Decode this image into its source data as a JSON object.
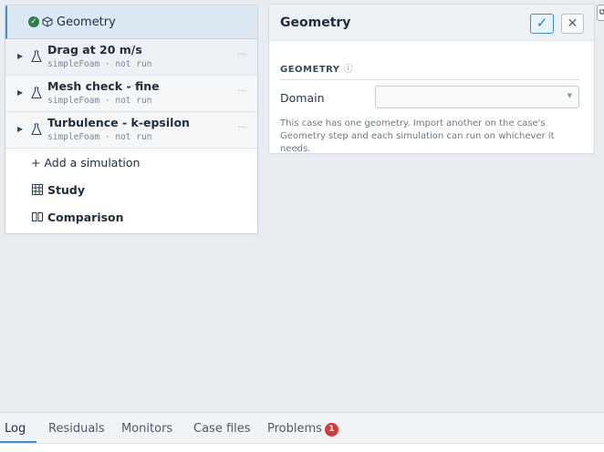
{
  "tree": {
    "geometry_label": "Geometry",
    "simulations": [
      {
        "title": "Drag at 20 m/s",
        "subtitle": "simpleFoam · not run"
      },
      {
        "title": "Mesh check - fine",
        "subtitle": "simpleFoam · not run"
      },
      {
        "title": "Turbulence - k-epsilon",
        "subtitle": "simpleFoam · not run"
      }
    ],
    "more_label": "···",
    "add_simulation": "+ Add a simulation",
    "study": "Study",
    "comparison": "Comparison"
  },
  "editor": {
    "title": "Geometry",
    "section_label": "GEOMETRY",
    "domain_label": "Domain",
    "domain_value": "",
    "hint": "This case has one geometry. Import another on the case's Geometry step and each simulation can run on whichever it needs."
  },
  "bottom": {
    "tabs": [
      "Log",
      "Residuals",
      "Monitors",
      "Case files",
      "Problems"
    ],
    "problems_count": "1"
  },
  "colors": {
    "accent": "#3f8fcf",
    "success": "#2e7d4a",
    "error": "#d23a3a"
  }
}
